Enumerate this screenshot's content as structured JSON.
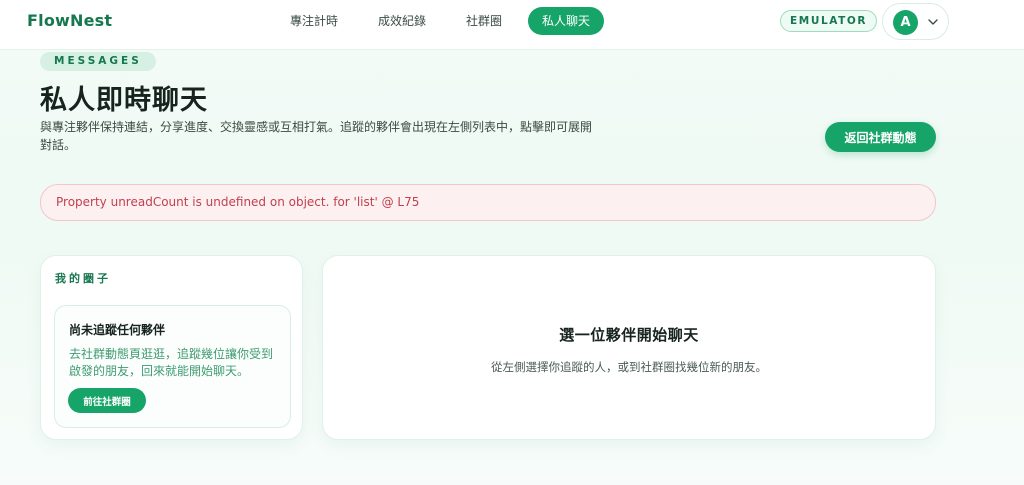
{
  "header": {
    "brand": "FlowNest",
    "nav": [
      {
        "label": "專注計時",
        "active": false
      },
      {
        "label": "成效紀錄",
        "active": false
      },
      {
        "label": "社群圈",
        "active": false
      },
      {
        "label": "私人聊天",
        "active": true
      }
    ],
    "emulator_badge": "EMULATOR",
    "avatar_initial": "A",
    "icons": {
      "user_menu": "chevron-down-icon"
    }
  },
  "page": {
    "eyebrow": "MESSAGES",
    "title": "私人即時聊天",
    "description": "與專注夥伴保持連結，分享進度、交換靈感或互相打氣。追蹤的夥伴會出現在左側列表中，點擊即可展開對話。",
    "back_button": "返回社群動態"
  },
  "error": {
    "message": "Property unreadCount is undefined on object. for 'list' @ L75"
  },
  "circle": {
    "title": "我的圈子",
    "empty_title": "尚未追蹤任何夥伴",
    "empty_desc": "去社群動態頁逛逛，追蹤幾位讓你受到啟發的朋友，回來就能開始聊天。",
    "goto_button": "前往社群圈"
  },
  "chat": {
    "title": "選一位夥伴開始聊天",
    "description": "從左側選擇你追蹤的人，或到社群圈找幾位新的朋友。"
  },
  "colors": {
    "accent": "#17a468",
    "brand": "#17774f",
    "error_text": "#c2404f",
    "error_bg": "#fdf0f1"
  }
}
